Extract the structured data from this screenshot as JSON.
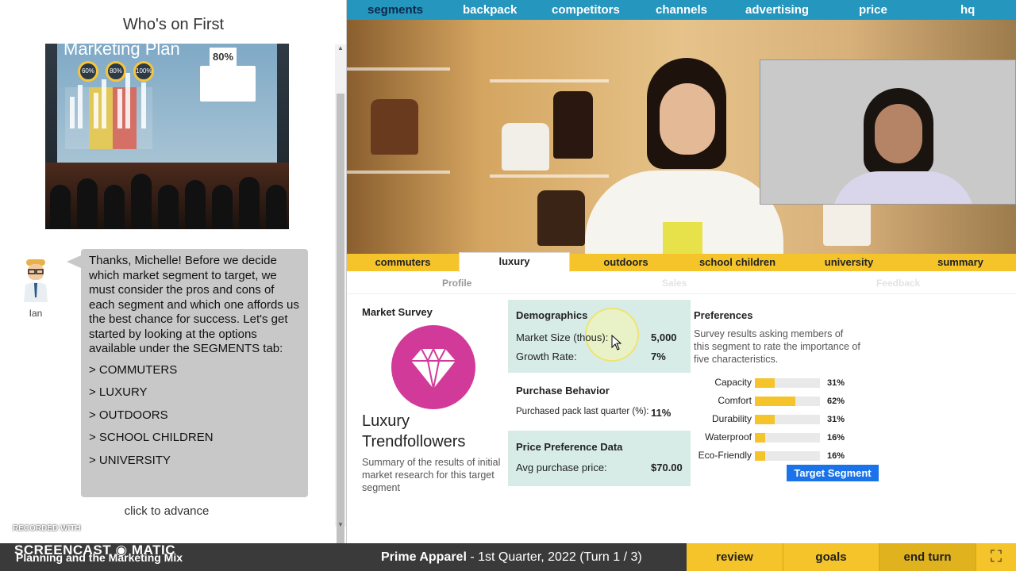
{
  "left_panel": {
    "title": "Who's on First",
    "slide": {
      "heading": "Marketing Plan",
      "badge": "80%",
      "stat_circles": [
        "60%",
        "80%",
        "100%"
      ]
    },
    "character_name": "Ian",
    "message": "Thanks, Michelle! Before we decide which market segment to target, we must consider the pros and cons of each segment and which one affords us the best chance for success. Let's get started by looking at the options available under the SEGMENTS tab:",
    "options": [
      "> COMMUTERS",
      "> LUXURY",
      "> OUTDOORS",
      "> SCHOOL CHILDREN",
      "> UNIVERSITY"
    ],
    "advance_label": "click to advance"
  },
  "top_nav": {
    "items": [
      "segments",
      "backpack",
      "competitors",
      "channels",
      "advertising",
      "price",
      "hq"
    ],
    "active": "segments"
  },
  "segment_tabs": {
    "items": [
      "commuters",
      "luxury",
      "outdoors",
      "school children",
      "university",
      "summary"
    ],
    "active": "luxury"
  },
  "sub_tabs": {
    "items": [
      "Profile",
      "Sales",
      "Feedback"
    ],
    "active": "Profile"
  },
  "market_survey": {
    "heading": "Market Survey",
    "icon": "diamond-icon",
    "segment_title_line1": "Luxury",
    "segment_title_line2": "Trendfollowers",
    "summary": "Summary of the results of initial market research for this target segment"
  },
  "demographics": {
    "heading": "Demographics",
    "market_size_label": "Market Size (thous):",
    "market_size_value": "5,000",
    "growth_rate_label": "Growth Rate:",
    "growth_rate_value": "7%"
  },
  "purchase_behavior": {
    "heading": "Purchase Behavior",
    "label": "Purchased pack last quarter (%):",
    "value": "11%"
  },
  "price_preference": {
    "heading": "Price Preference Data",
    "label": "Avg purchase price:",
    "value": "$70.00"
  },
  "preferences": {
    "heading": "Preferences",
    "description": "Survey results asking members of this segment to rate the importance of five characteristics.",
    "items": [
      {
        "name": "Capacity",
        "pct_label": "31%",
        "value": 0.31
      },
      {
        "name": "Comfort",
        "pct_label": "62%",
        "value": 0.62
      },
      {
        "name": "Durability",
        "pct_label": "31%",
        "value": 0.31
      },
      {
        "name": "Waterproof",
        "pct_label": "16%",
        "value": 0.16
      },
      {
        "name": "Eco-Friendly",
        "pct_label": "16%",
        "value": 0.16
      }
    ],
    "target_button": "Target Segment"
  },
  "bottom_bar": {
    "recorded_with": "RECORDED WITH",
    "logo": "SCREENCAST ◉ MATIC",
    "left_caption": "Planning and the Marketing Mix",
    "company": "Prime Apparel",
    "turn_info": " - 1st Quarter, 2022 (Turn 1 / 3)",
    "buttons": [
      "review",
      "goals",
      "end turn"
    ]
  },
  "colors": {
    "nav_blue": "#2596be",
    "accent_yellow": "#f5c42a",
    "panel_green": "#d7ece7",
    "diamond_pink": "#d23a9a",
    "button_blue": "#1a73e8"
  }
}
